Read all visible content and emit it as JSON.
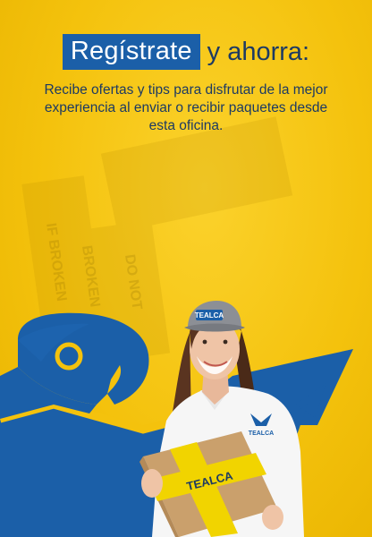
{
  "headline": {
    "highlight": "Regístrate",
    "rest": "y ahorra:"
  },
  "subtitle": "Recibe ofertas y tips para disfrutar de la mejor experiencia al enviar o recibir paquetes desde esta oficina.",
  "brand": {
    "cap_logo_text": "TEALCA",
    "shirt_logo_text": "TEALCA",
    "box_tape_text": "TEALCA"
  },
  "background_tape_text": [
    "DO NOT",
    "BROKEN",
    "IF BROKEN"
  ],
  "colors": {
    "background_yellow": "#f4c20d",
    "brand_blue": "#1b5fa8",
    "text_navy": "#1d3a63"
  },
  "icons": {
    "eagle_logo": "eagle-logo-icon"
  }
}
